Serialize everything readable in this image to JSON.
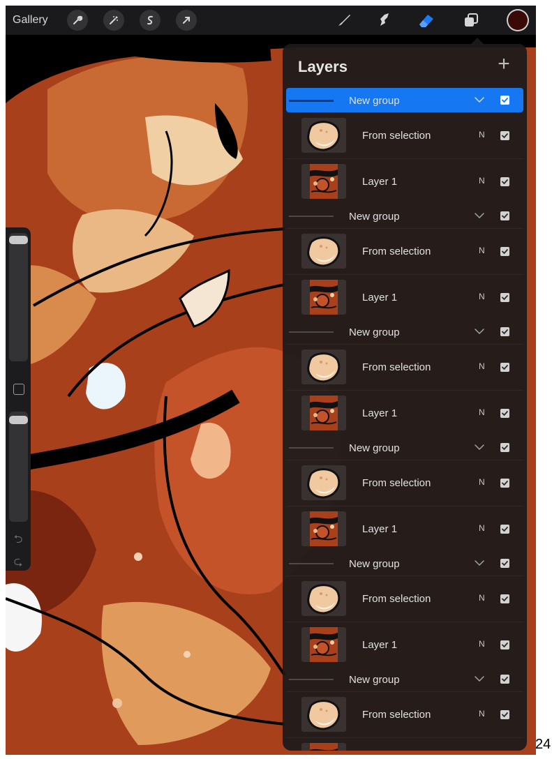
{
  "topbar": {
    "gallery_label": "Gallery",
    "left_icons": [
      "wrench-icon",
      "magic-wand-icon",
      "selection-icon",
      "transform-arrow-icon"
    ],
    "right_tools": [
      "brush-icon",
      "smudge-icon",
      "eraser-icon",
      "layers-icon"
    ],
    "active_tool": "eraser-icon",
    "current_color": "#3a0b06"
  },
  "sidebar": {
    "icons": [
      "undo-icon",
      "redo-icon"
    ]
  },
  "layers_panel": {
    "title": "Layers",
    "add_icon": "plus-icon",
    "accent_color": "#1677f2",
    "rows": [
      {
        "type": "group",
        "name": "New group",
        "selected": true,
        "visible": true
      },
      {
        "type": "layer",
        "name": "From selection",
        "blend": "N",
        "visible": true,
        "thumb": "selection-blob"
      },
      {
        "type": "layer",
        "name": "Layer 1",
        "blend": "N",
        "visible": true,
        "thumb": "artwork"
      },
      {
        "type": "group",
        "name": "New group",
        "selected": false,
        "visible": true
      },
      {
        "type": "layer",
        "name": "From selection",
        "blend": "N",
        "visible": true,
        "thumb": "selection-blob"
      },
      {
        "type": "layer",
        "name": "Layer 1",
        "blend": "N",
        "visible": true,
        "thumb": "artwork"
      },
      {
        "type": "group",
        "name": "New group",
        "selected": false,
        "visible": true
      },
      {
        "type": "layer",
        "name": "From selection",
        "blend": "N",
        "visible": true,
        "thumb": "selection-blob"
      },
      {
        "type": "layer",
        "name": "Layer 1",
        "blend": "N",
        "visible": true,
        "thumb": "artwork"
      },
      {
        "type": "group",
        "name": "New group",
        "selected": false,
        "visible": true
      },
      {
        "type": "layer",
        "name": "From selection",
        "blend": "N",
        "visible": true,
        "thumb": "selection-blob"
      },
      {
        "type": "layer",
        "name": "Layer 1",
        "blend": "N",
        "visible": true,
        "thumb": "artwork"
      },
      {
        "type": "group",
        "name": "New group",
        "selected": false,
        "visible": true
      },
      {
        "type": "layer",
        "name": "From selection",
        "blend": "N",
        "visible": true,
        "thumb": "selection-blob"
      },
      {
        "type": "layer",
        "name": "Layer 1",
        "blend": "N",
        "visible": true,
        "thumb": "artwork"
      },
      {
        "type": "group",
        "name": "New group",
        "selected": false,
        "visible": true
      },
      {
        "type": "layer",
        "name": "From selection",
        "blend": "N",
        "visible": true,
        "thumb": "selection-blob"
      },
      {
        "type": "layer",
        "name": "",
        "blend": "",
        "visible": true,
        "thumb": "artwork"
      }
    ]
  },
  "page_number": "24"
}
